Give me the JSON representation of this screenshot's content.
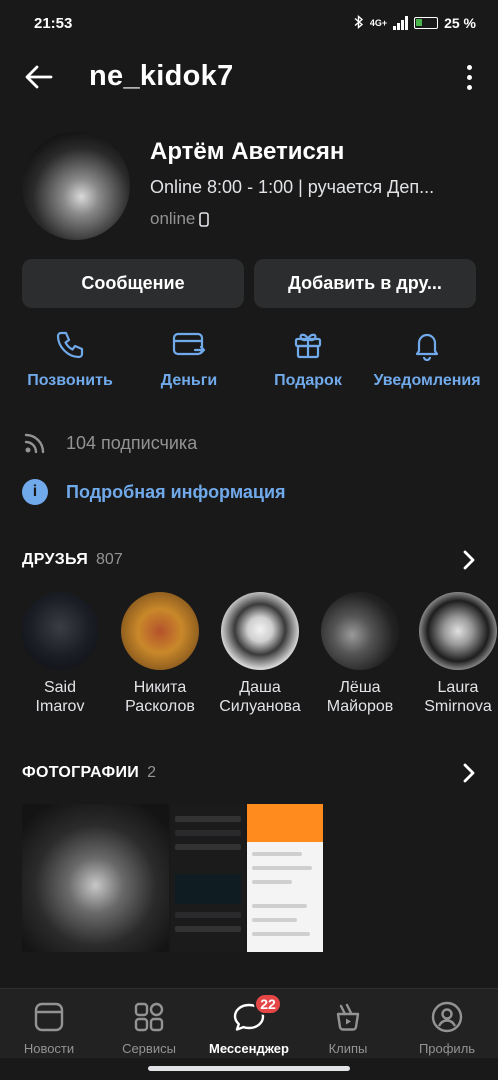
{
  "status_bar": {
    "time": "21:53",
    "network": "4G+",
    "battery": "25 %"
  },
  "header": {
    "title": "ne_kidok7"
  },
  "profile": {
    "name": "Артём Аветисян",
    "status": "Online 8:00 - 1:00 | ручается Деп...",
    "online": "online"
  },
  "buttons": {
    "message": "Сообщение",
    "add_friend": "Добавить в дру..."
  },
  "actions": [
    {
      "label": "Позвонить",
      "icon": "phone-icon"
    },
    {
      "label": "Деньги",
      "icon": "money-icon"
    },
    {
      "label": "Подарок",
      "icon": "gift-icon"
    },
    {
      "label": "Уведомления",
      "icon": "bell-icon"
    }
  ],
  "followers": {
    "text": "104 подписчика"
  },
  "info": {
    "text": "Подробная информация"
  },
  "friends": {
    "title": "ДРУЗЬЯ",
    "count": "807",
    "items": [
      {
        "first": "Said",
        "last": "Imarov"
      },
      {
        "first": "Никита",
        "last": "Расколов"
      },
      {
        "first": "Даша",
        "last": "Силуанова"
      },
      {
        "first": "Лёша",
        "last": "Майоров"
      },
      {
        "first": "Laura",
        "last": "Smirnova"
      }
    ]
  },
  "photos": {
    "title": "ФОТОГРАФИИ",
    "count": "2"
  },
  "tabs": [
    {
      "label": "Новости"
    },
    {
      "label": "Сервисы"
    },
    {
      "label": "Мессенджер",
      "badge": "22"
    },
    {
      "label": "Клипы"
    },
    {
      "label": "Профиль"
    }
  ],
  "colors": {
    "accent": "#71aaeb",
    "background": "#19191a",
    "badge": "#e64646"
  }
}
